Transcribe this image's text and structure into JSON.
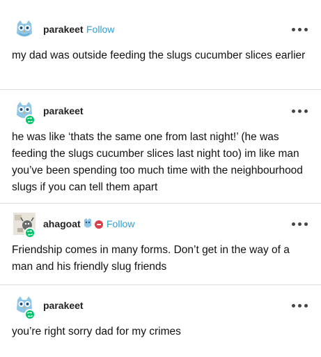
{
  "colors": {
    "accent": "#2f9fd6",
    "reblog": "#00c46a",
    "divider": "#dcdcdc"
  },
  "posts": [
    {
      "username": "parakeet",
      "follow_label": "Follow",
      "avatar_icon": "owl-avatar-icon",
      "text": "my dad was outside feeding the slugs cucumber slices earlier"
    },
    {
      "username": "parakeet",
      "avatar_icon": "owl-avatar-icon",
      "reblog_icon": "reblog-icon",
      "text": "he was like ‘thats the same one from last night!’ (he was feeding the slugs cucumber slices last night too) im like man you’ve been spending too much time with the neighbourhood slugs if you can tell them apart"
    },
    {
      "username": "ahagoat",
      "follow_label": "Follow",
      "avatar_icon": "goat-avatar-icon",
      "reblog_icon": "reblog-icon",
      "badges": [
        "blue-badge-icon",
        "red-badge-icon"
      ],
      "text": "Friendship comes in many forms. Don’t get in the way of a man and his friendly slug friends"
    },
    {
      "username": "parakeet",
      "avatar_icon": "owl-avatar-icon",
      "reblog_icon": "reblog-icon",
      "text": "you’re right sorry dad for my crimes"
    }
  ]
}
